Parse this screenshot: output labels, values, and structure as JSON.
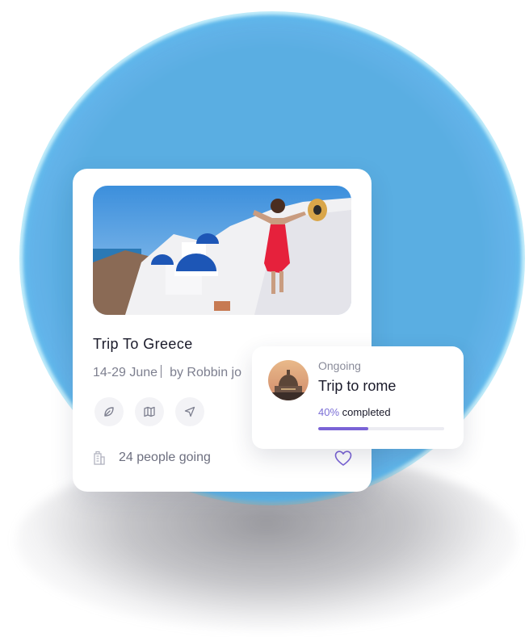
{
  "trip_card": {
    "title": "Trip To Greece",
    "dates": "14-29 June",
    "organizer": "by Robbin jo",
    "action_icons": [
      "leaf-icon",
      "map-icon",
      "navigation-arrow-icon"
    ],
    "people_going": "24 people going",
    "building_icon": "building-icon",
    "favorite_icon": "heart-icon"
  },
  "ongoing_card": {
    "status": "Ongoing",
    "title": "Trip to rome",
    "progress_pct_text": "40%",
    "progress_suffix": " completed",
    "progress_value": 0.4
  },
  "colors": {
    "accent": "#7a63d6",
    "background_glow": "#5aaee2",
    "text_dark": "#1a1a2a",
    "text_muted": "#7d7f8f"
  }
}
